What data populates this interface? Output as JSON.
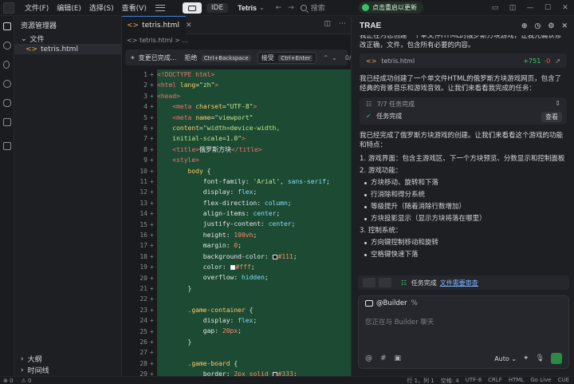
{
  "titlebar": {
    "menus": [
      "文件(F)",
      "编辑(E)",
      "选择(S)",
      "查看(V)"
    ],
    "ide_label": "IDE",
    "project": "Tetris",
    "search_label": "搜索",
    "update_label": "点击重启以更新"
  },
  "explorer": {
    "title": "资源管理器",
    "folder": "文件",
    "file": "tetris.html",
    "outline": "大纲",
    "timeline": "时间线"
  },
  "editor": {
    "tab_label": "tetris.html",
    "breadcrumb": "<> tetris.html > ...",
    "diff": {
      "title": "变更已完成...",
      "reject": "拒绝",
      "reject_key": "Ctrl+Backspace",
      "accept": "接受",
      "accept_key": "Ctrl+Enter",
      "counter": "0/0"
    }
  },
  "chat": {
    "title": "TRAE",
    "intro": "我正在为您创建一个单文件HTML的俄罗斯方块游戏，让我先确认修改正确，文件，包含所有必要的内容。",
    "file_card": {
      "name": "tetris.html",
      "added": "+751",
      "removed": "-0"
    },
    "summary": "我已经成功创建了一个单文件HTML的俄罗斯方块游戏网页，包含了经典的背景音乐和游戏音效。让我们来看看我完成的任务：",
    "task_card": {
      "progress": "7/7 任务完成",
      "status": "任务完成",
      "view": "查看"
    },
    "features_intro": "我已经完成了俄罗斯方块游戏的创建。让我们来看看这个游戏的功能和特点：",
    "sections": [
      {
        "num": "1.",
        "title": "游戏界面：包含主游戏区、下一个方块预览、分数显示和控制面板"
      },
      {
        "num": "2.",
        "title": "游戏功能："
      },
      {
        "num": "3.",
        "title": "控制系统："
      }
    ],
    "game_features": [
      "方块移动、旋转和下落",
      "行消除和得分系统",
      "等级提升（随着消除行数增加）",
      "方块投影显示（显示方块将落在哪里）"
    ],
    "controls": [
      "方向键控制移动和旋转",
      "空格键快速下落"
    ],
    "task_strip": {
      "status": "任务完成",
      "link": "文件需要审查"
    },
    "input": {
      "agent": "@Builder",
      "placeholder": "您正在与 Builder 聊天",
      "mode": "Auto"
    }
  },
  "statusbar": {
    "left": [
      "⊗ 0",
      "⚠ 0"
    ],
    "right": [
      "行 1，列 1",
      "空格: 4",
      "UTF-8",
      "CRLF",
      "HTML",
      "Go Live",
      "CUE"
    ]
  }
}
